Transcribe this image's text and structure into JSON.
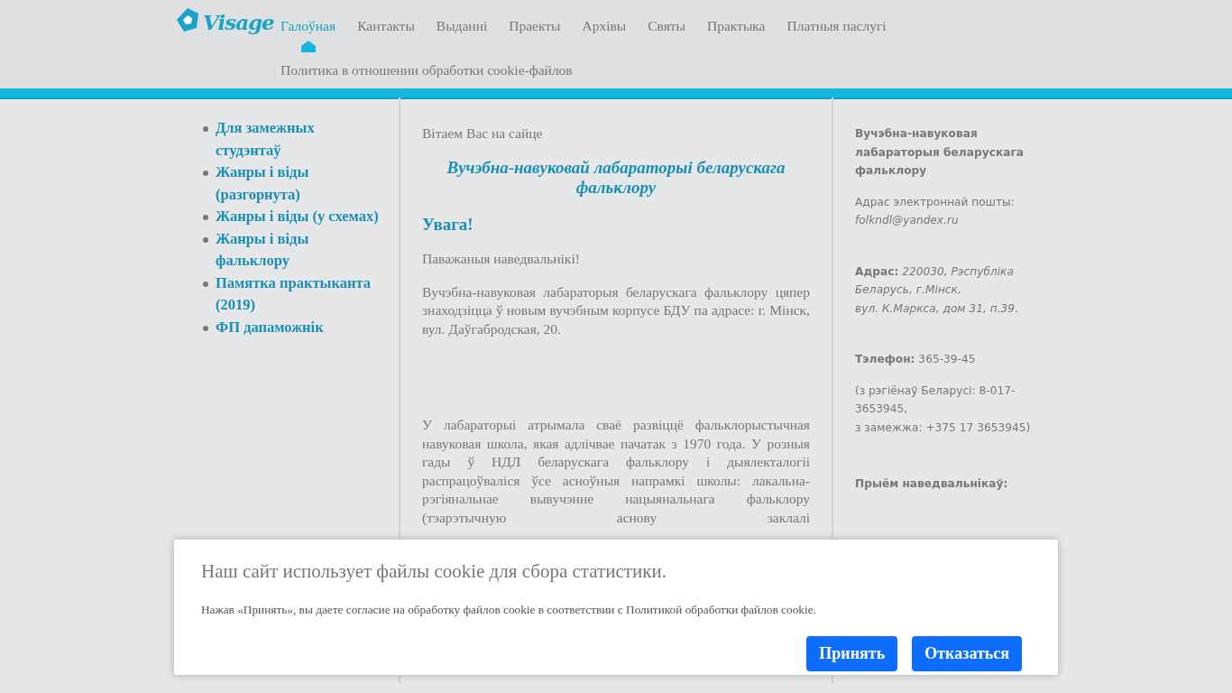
{
  "logo": {
    "text": "Visage"
  },
  "nav": [
    {
      "label": "Галоўная",
      "selected": true
    },
    {
      "label": "Кантакты",
      "selected": false
    },
    {
      "label": "Выданні",
      "selected": false
    },
    {
      "label": "Праекты",
      "selected": false
    },
    {
      "label": "Архівы",
      "selected": false
    },
    {
      "label": "Святы",
      "selected": false
    },
    {
      "label": "Практыка",
      "selected": false
    },
    {
      "label": "Платныя паслугі",
      "selected": false
    },
    {
      "label": "Политика в отношении обработки cookie-файлов",
      "selected": false
    }
  ],
  "sidebar": {
    "items": [
      "Для замежных студэнтаў",
      "Жанры і віды (разгорнута)",
      "Жанры і віды (у схемах)",
      "Жанры і віды фальклору",
      "Памятка практыканта (2019)",
      "ФП дапаможнік"
    ]
  },
  "main": {
    "greeting": "Вітаем Вас на сайце",
    "title": "Вучэбна-навуковай лабараторыі беларускага фальклору",
    "heading": "Увага!",
    "paragraphs": [
      "Паважаныя наведвальнікі!",
      "Вучэбна-навуковая лабараторыя беларускага фальклору цяпер знаходзіцца ў новым вучэбным корпусе БДУ па адрасе: г. Мінск, вул. Даўгабродская, 20.",
      "У лабараторыі атрымала сваё развіццё фальклорыстычная навуковая школа, якая адлічвае пачатак з 1970 года. У розныя гады ў НДЛ беларускага фальклору і дыялекталогіі распрацоўваліся ўсе асноўныя напрамкі школы: лакальна-рэгіянальнае вывучэнне нацыянальнага фальклору (тэарэтычную аснову заклалі"
    ]
  },
  "contacts": [
    {
      "lines": [
        "**Вучэбна-навуковая лабараторыя беларускага фальклору**"
      ]
    },
    {
      "lines": [
        "Адрас электроннай пошты:",
        "*folkndl@yandex.ru*"
      ]
    },
    {
      "lines": [
        "**Адрас:** *220030, Рэспубліка Беларусь, г.Мінск,*",
        "*вул. К.Маркса, дом 31, п.39*."
      ]
    },
    {
      "lines": [
        "**Тэлефон:** 365-39-45"
      ]
    },
    {
      "lines": [
        "(з рэгіёнаў Беларусі: 8-017-3653945,",
        "з замежжа: +375 17 3653945)"
      ]
    },
    {
      "lines": [
        "**Прыём наведвальнікаў:**"
      ]
    }
  ],
  "cookie": {
    "title": "Наш сайт использует файлы cookie для сбора статистики.",
    "text": "Нажав «Принять», вы даете согласие на обработку файлов cookie в соответствии с Политикой обработки файлов cookie.",
    "buttons": [
      "Принять",
      "Отказаться"
    ]
  }
}
